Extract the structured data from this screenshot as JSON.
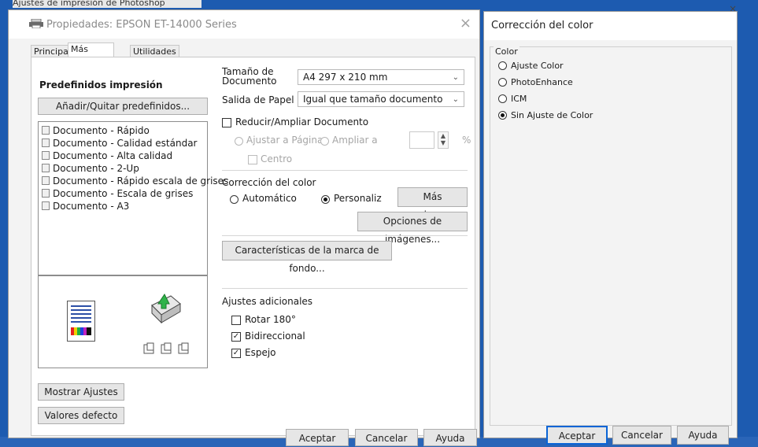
{
  "background": {
    "title": "Ajustes de impresión de Photoshop",
    "close_glyph": "×"
  },
  "main_window": {
    "title": "Propiedades: EPSON ET-14000 Series",
    "close_glyph": "×",
    "icon": "printer-icon",
    "tabs": [
      {
        "label": "Principal"
      },
      {
        "label": "Más Opciones"
      },
      {
        "label": "Utilidades"
      }
    ],
    "presets": {
      "heading": "Predefinidos impresión",
      "add_remove_button": "Añadir/Quitar predefinidos...",
      "items": [
        "Documento - Rápido",
        "Documento - Calidad estándar",
        "Documento - Alta calidad",
        "Documento - 2-Up",
        "Documento - Rápido escala de grises",
        "Documento - Escala de grises",
        "Documento - A3"
      ]
    },
    "document_size": {
      "label": "Tamaño de Documento",
      "value": "A4 297 x 210 mm"
    },
    "paper_output": {
      "label": "Salida de Papel",
      "value": "Igual que tamaño documento"
    },
    "reduce_enlarge": {
      "label": "Reducir/Ampliar Documento",
      "fit_page": "Ajustar a Página",
      "enlarge_to": "Ampliar a",
      "percent_unit": "%",
      "center": "Centro"
    },
    "color_correction": {
      "label": "Corrección del color",
      "automatic": "Automático",
      "custom": "Personaliz",
      "more_options_button": "Más opciones...",
      "image_options_button": "Opciones de imágenes..."
    },
    "watermark_button": "Características de la marca de fondo...",
    "additional": {
      "label": "Ajustes adicionales",
      "rotate": "Rotar 180°",
      "bidirectional": "Bidireccional",
      "mirror": "Espejo"
    },
    "show_settings_button": "Mostrar Ajustes",
    "defaults_button": "Valores defecto",
    "bottom_buttons": [
      "Aceptar",
      "Cancelar",
      "Ayuda"
    ]
  },
  "color_window": {
    "title": "Corrección del color",
    "group_label": "Color",
    "options": [
      {
        "label": "Ajuste Color",
        "selected": false
      },
      {
        "label": "PhotoEnhance",
        "selected": false
      },
      {
        "label": "ICM",
        "selected": false
      },
      {
        "label": "Sin Ajuste de Color",
        "selected": true
      }
    ],
    "buttons": {
      "accept": "Aceptar",
      "cancel": "Cancelar",
      "help": "Ayuda"
    }
  },
  "colors": {
    "desktop": "#2a65b8",
    "accent": "#0a64d6",
    "panel": "#f3f3f3"
  }
}
